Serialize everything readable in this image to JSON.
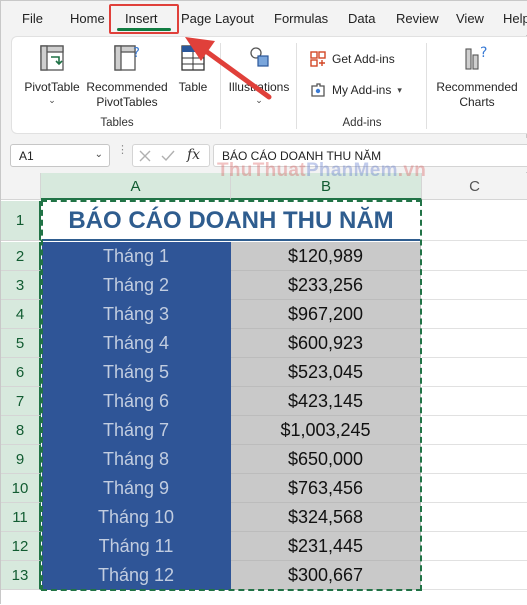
{
  "menu_tabs": [
    "File",
    "Home",
    "Insert",
    "Page Layout",
    "Formulas",
    "Data",
    "Review",
    "View",
    "Help"
  ],
  "active_tab": "Insert",
  "ribbon": {
    "pivot_table": "PivotTable",
    "recommended_pivot_1": "Recommended",
    "recommended_pivot_2": "PivotTables",
    "table": "Table",
    "tables_group": "Tables",
    "illustrations": "Illustrations",
    "get_addins": "Get Add-ins",
    "my_addins": "My Add-ins",
    "addins_group": "Add-ins",
    "recommended_charts_1": "Recommended",
    "recommended_charts_2": "Charts"
  },
  "formula_bar": {
    "name_box": "A1",
    "fx": "fx",
    "content": "BÁO CÁO DOANH THU NĂM"
  },
  "columns": [
    "A",
    "B",
    "C"
  ],
  "rows": [
    "1",
    "2",
    "3",
    "4",
    "5",
    "6",
    "7",
    "8",
    "9",
    "10",
    "11",
    "12",
    "13"
  ],
  "sheet": {
    "title": "BÁO CÁO DOANH THU NĂM",
    "data": [
      {
        "month": "Tháng 1",
        "amount": "$120,989"
      },
      {
        "month": "Tháng 2",
        "amount": "$233,256"
      },
      {
        "month": "Tháng 3",
        "amount": "$967,200"
      },
      {
        "month": "Tháng 4",
        "amount": "$600,923"
      },
      {
        "month": "Tháng 5",
        "amount": "$523,045"
      },
      {
        "month": "Tháng 6",
        "amount": "$423,145"
      },
      {
        "month": "Tháng 7",
        "amount": "$1,003,245"
      },
      {
        "month": "Tháng 8",
        "amount": "$650,000"
      },
      {
        "month": "Tháng 9",
        "amount": "$763,456"
      },
      {
        "month": "Tháng 10",
        "amount": "$324,568"
      },
      {
        "month": "Tháng 11",
        "amount": "$231,445"
      },
      {
        "month": "Tháng 12",
        "amount": "$300,667"
      }
    ]
  },
  "watermark": {
    "part1": "ThuThuat",
    "part2": "PhanMem",
    "part3": ".vn"
  },
  "colors": {
    "accent": "#107c41",
    "highlight": "#e0403a",
    "month_fill": "#2f5597",
    "amount_fill": "#c9c9c9",
    "title_text": "#2f5d8f"
  }
}
